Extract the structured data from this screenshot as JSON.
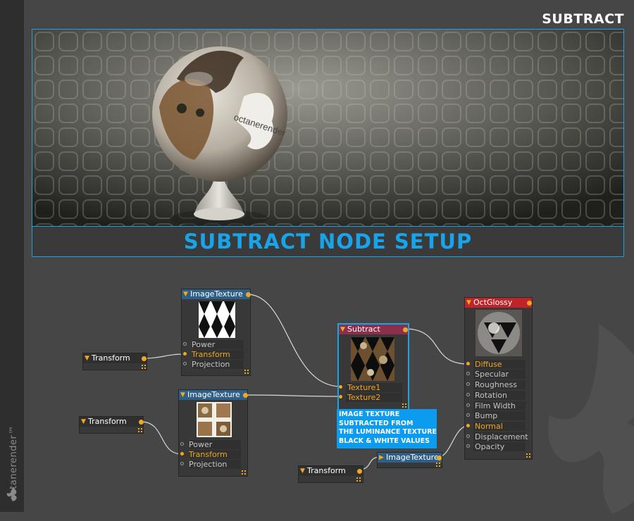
{
  "page": {
    "title": "SUBTRACT"
  },
  "banner": {
    "title": "SUBTRACT NODE SETUP"
  },
  "brand": {
    "text": "octanerender™"
  },
  "render": {
    "logo_text": "octanerender"
  },
  "colors": {
    "accent": "#18a4ea",
    "port_active": "#f1a71e",
    "imagetexture_header": "#2f5f86",
    "glossy_header": "#c0232a",
    "subtract_header": "#8b2f4d"
  },
  "nodes": {
    "image_texture_1": {
      "title": "ImageTexture",
      "inputs": [
        "Power",
        "Transform",
        "Projection"
      ]
    },
    "image_texture_2": {
      "title": "ImageTexture",
      "inputs": [
        "Power",
        "Transform",
        "Projection"
      ]
    },
    "image_texture_3": {
      "title": "ImageTexture"
    },
    "transform_1": {
      "title": "Transform"
    },
    "transform_2": {
      "title": "Transform"
    },
    "transform_3": {
      "title": "Transform"
    },
    "subtract": {
      "title": "Subtract",
      "inputs": [
        "Texture1",
        "Texture2"
      ]
    },
    "oct_glossy": {
      "title": "OctGlossy",
      "inputs": [
        "Diffuse",
        "Specular",
        "Roughness",
        "Rotation",
        "Film Width",
        "Bump",
        "Normal",
        "Displacement",
        "Opacity"
      ]
    }
  },
  "note": {
    "lines": [
      "IMAGE TEXTURE",
      "SUBTRACTED FROM",
      "THE LUMINANCE TEXTURE",
      "BLACK & WHITE VALUES"
    ]
  }
}
